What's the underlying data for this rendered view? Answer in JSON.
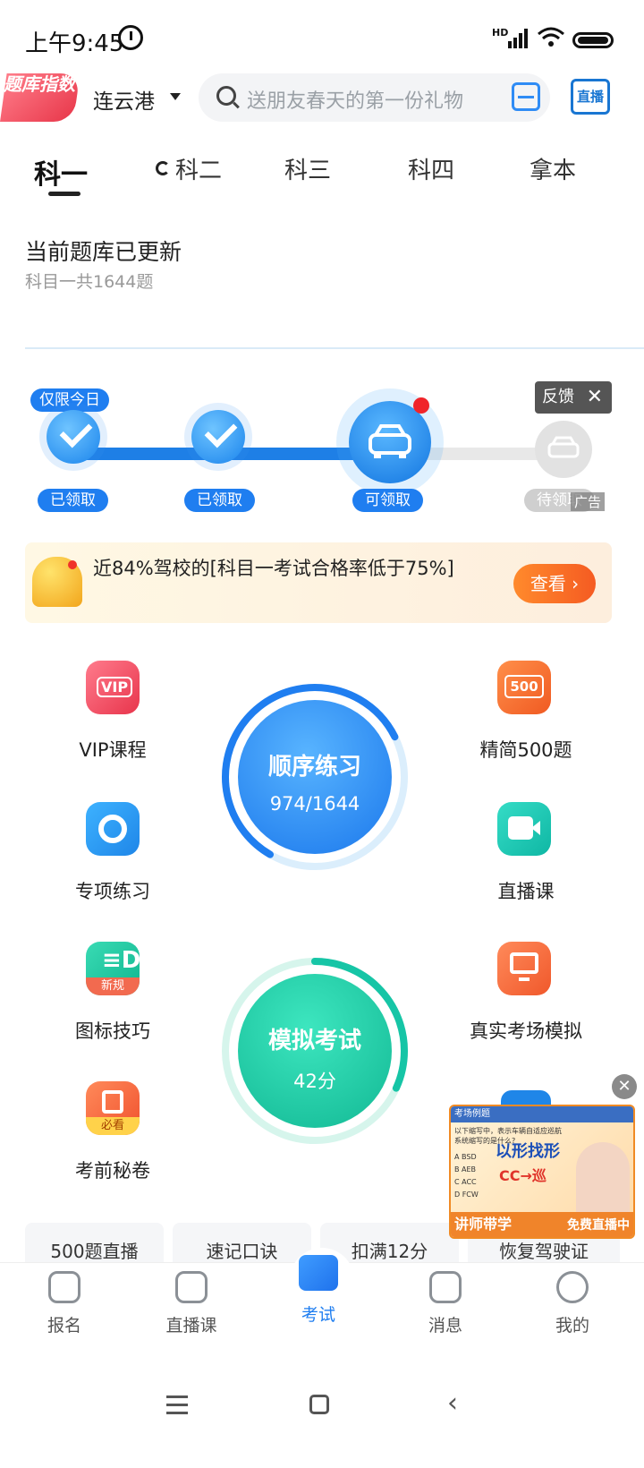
{
  "status_bar": {
    "time": "上午9:45",
    "hd": "HD"
  },
  "header": {
    "badge": "题库指数",
    "city": "连云港",
    "search_placeholder": "送朋友春天的第一份礼物",
    "live_label": "直播"
  },
  "tabs": [
    {
      "label": "科一",
      "active": true
    },
    {
      "label": "科二"
    },
    {
      "label": "科三"
    },
    {
      "label": "科四"
    },
    {
      "label": "拿本"
    }
  ],
  "update": {
    "title": "当前题库已更新",
    "subtitle": "科目一共1644题"
  },
  "reward": {
    "tag": "仅限今日",
    "steps": [
      {
        "label": "已领取"
      },
      {
        "label": "已领取"
      },
      {
        "label": "可领取"
      },
      {
        "label": "待领取"
      }
    ],
    "feedback": "反馈",
    "ad": "广告"
  },
  "notice": {
    "text": "近84%驾校的[科目一考试合格率低于75%]",
    "button": "查看 ›"
  },
  "grid": {
    "left": [
      {
        "label": "VIP课程",
        "icon": "vip-icon",
        "color": "#ef3f54"
      },
      {
        "label": "专项练习",
        "icon": "target-icon",
        "color": "#1f9be8"
      },
      {
        "label": "图标技巧",
        "icon": "sign-icon",
        "color": "#17c29a",
        "tag": "新规"
      },
      {
        "label": "考前秘卷",
        "icon": "paper-icon",
        "color": "#f55a37",
        "tag": "必看"
      }
    ],
    "right": [
      {
        "label": "精简500题",
        "icon": "500-icon",
        "color": "#f56b2c",
        "text": "500"
      },
      {
        "label": "直播课",
        "icon": "video-icon",
        "color": "#12c6b3"
      },
      {
        "label": "真实考场模拟",
        "icon": "monitor-icon",
        "color": "#f36c33"
      }
    ],
    "practice": {
      "title": "顺序练习",
      "progress": "974/1644",
      "fraction": 0.5925
    },
    "exam": {
      "title": "模拟考试",
      "score": "42分"
    }
  },
  "tiles": [
    "500题直播",
    "速记口诀",
    "扣满12分",
    "恢复驾驶证"
  ],
  "video": {
    "header": "考场例题",
    "question": "以下缩写中，表示车辆自适应巡航系统缩写的是什么?",
    "options": [
      "A BSD",
      "B AEB",
      "C ACC",
      "D FCW"
    ],
    "headline": "以形找形",
    "formula": "CC→巡",
    "left_caption": "讲师带学",
    "right_caption": "免费直播中"
  },
  "nav": [
    {
      "label": "报名",
      "icon": "form-icon"
    },
    {
      "label": "直播课",
      "icon": "tv-icon"
    },
    {
      "label": "考试",
      "icon": "folder-check-icon",
      "active": true
    },
    {
      "label": "消息",
      "icon": "message-icon"
    },
    {
      "label": "我的",
      "icon": "smile-icon"
    }
  ]
}
